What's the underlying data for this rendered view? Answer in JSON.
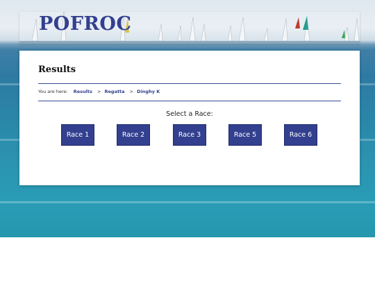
{
  "site": {
    "logo": "POFROC"
  },
  "page": {
    "title": "Results"
  },
  "breadcrumb": {
    "prefix": "You are here:",
    "items": [
      "Results",
      "Regatta",
      "Dinghy K"
    ],
    "separator": ">"
  },
  "race_select": {
    "label": "Select a Race:",
    "buttons": [
      "Race 1",
      "Race 2",
      "Race 3",
      "Race 5",
      "Race 6"
    ]
  },
  "colors": {
    "accent": "#33408f",
    "button_text": "#ffffff"
  }
}
